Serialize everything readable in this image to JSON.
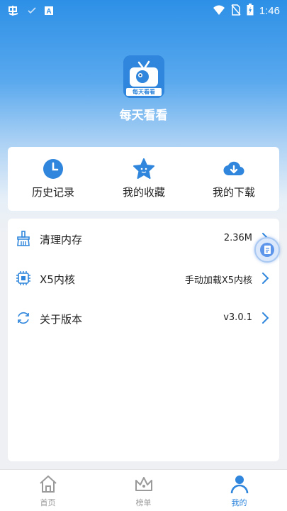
{
  "status_bar": {
    "time": "1:46",
    "left_icons": [
      "app-notification-icon",
      "check-icon",
      "a-badge-icon"
    ],
    "right_icons": [
      "wifi-icon",
      "no-sim-icon",
      "battery-charging-icon"
    ]
  },
  "app": {
    "name": "每天看看",
    "logo_text": "每天看看"
  },
  "quick_actions": [
    {
      "label": "历史记录",
      "icon": "clock-icon"
    },
    {
      "label": "我的收藏",
      "icon": "star-icon"
    },
    {
      "label": "我的下载",
      "icon": "cloud-download-icon"
    }
  ],
  "settings": [
    {
      "label": "清理内存",
      "value": "2.36M",
      "icon": "broom-icon"
    },
    {
      "label": "X5内核",
      "value": "手动加载X5内核",
      "icon": "chip-icon"
    },
    {
      "label": "关于版本",
      "value": "v3.0.1",
      "icon": "refresh-icon"
    }
  ],
  "bottom_nav": [
    {
      "label": "首页",
      "icon": "home-icon",
      "active": false
    },
    {
      "label": "榜单",
      "icon": "crown-icon",
      "active": false
    },
    {
      "label": "我的",
      "icon": "person-icon",
      "active": true
    }
  ],
  "colors": {
    "accent": "#2f86dc",
    "inactive": "#9a9a9a"
  }
}
